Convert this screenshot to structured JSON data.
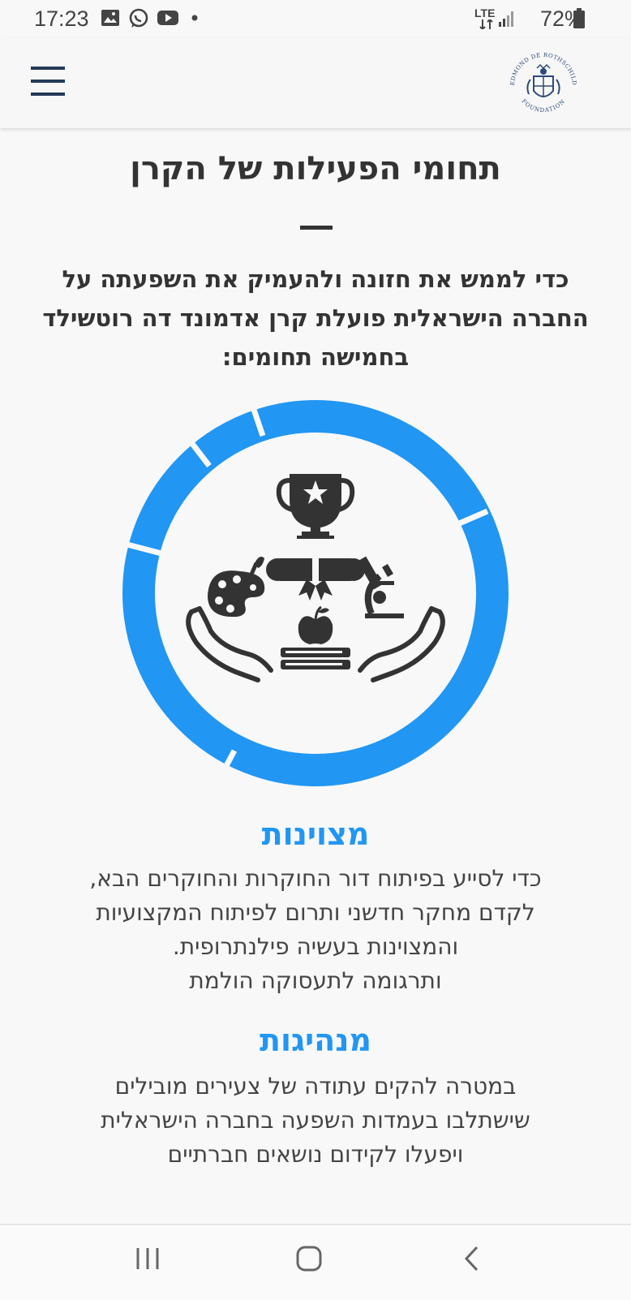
{
  "status_bar": {
    "time": "17:23",
    "network": "LTE",
    "battery": "72%",
    "icons": [
      "gallery-icon",
      "whatsapp-icon",
      "youtube-icon",
      "notification-dot-icon",
      "signal-icon",
      "battery-icon"
    ]
  },
  "header": {
    "menu_icon": "hamburger-icon",
    "logo_text_top": "EDMOND DE ROTHSCHILD",
    "logo_text_bottom": "FOUNDATION"
  },
  "page": {
    "title": "תחומי הפעילות של הקרן",
    "intro": "כדי לממש את חזונה ולהעמיק את השפעתה על החברה הישראלית פועלת קרן אדמונד דה רוטשילד בחמישה תחומים:"
  },
  "activity_ring": {
    "segment_count": 5,
    "color": "#2196f3",
    "icons": [
      "trophy-icon",
      "palette-icon",
      "diploma-icon",
      "microscope-icon",
      "apple-book-icon",
      "hands-icon"
    ]
  },
  "sections": [
    {
      "title": "מצוינות",
      "text": "כדי לסייע בפיתוח דור החוקרות והחוקרים הבא,\nלקדם מחקר חדשני ותרום לפיתוח המקצועיות\nוהמצוינות בעשיה פילנתרופית.\nותרגומה לתעסוקה הולמת"
    },
    {
      "title": "מנהיגות",
      "text": "במטרה להקים עתודה של צעירים מובילים\nשישתלבו בעמדות השפעה בחברה הישראלית\nויפעלו לקידום נושאים חברתיים"
    }
  ],
  "nav_bar": {
    "icons": [
      "recent-apps-icon",
      "home-icon",
      "back-icon"
    ]
  },
  "colors": {
    "accent": "#2196f3",
    "text": "#333333",
    "navy": "#233a56",
    "background": "#f8f8f8"
  }
}
